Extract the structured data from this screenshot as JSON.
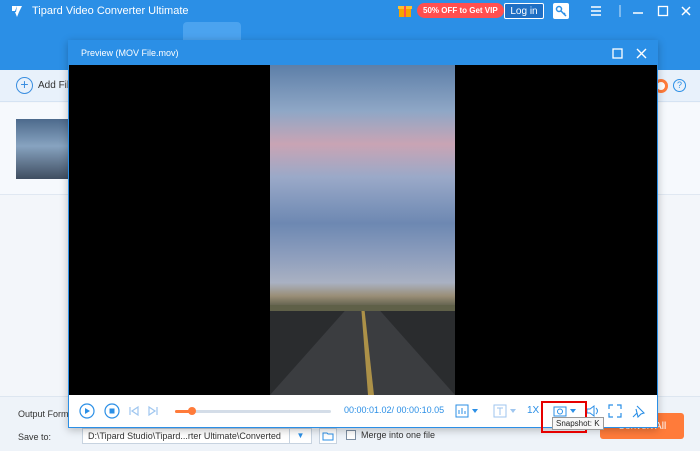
{
  "app": {
    "title": "Tipard Video Converter Ultimate"
  },
  "titlebar": {
    "promo": "50% OFF to Get VIP",
    "login": "Log in"
  },
  "toolbar": {
    "add_files": "Add File"
  },
  "preview": {
    "title": "Preview (MOV File.mov)",
    "current_time": "00:00:01.02",
    "total_time": "/ 00:00:10.05",
    "progress": 0.11,
    "speed": "1X",
    "snapshot_tooltip": "Snapshot: K"
  },
  "bottom": {
    "output_format_label": "Output Forma",
    "save_to_label": "Save to:",
    "save_path": "D:\\Tipard Studio\\Tipard...rter Ultimate\\Converted",
    "merge_label": "Merge into one file",
    "convert_all": "Convert All"
  },
  "colors": {
    "accent": "#2b8fe6",
    "convert": "#ff7b3a",
    "promo": "#ff4f4f",
    "highlight": "#e60000"
  }
}
